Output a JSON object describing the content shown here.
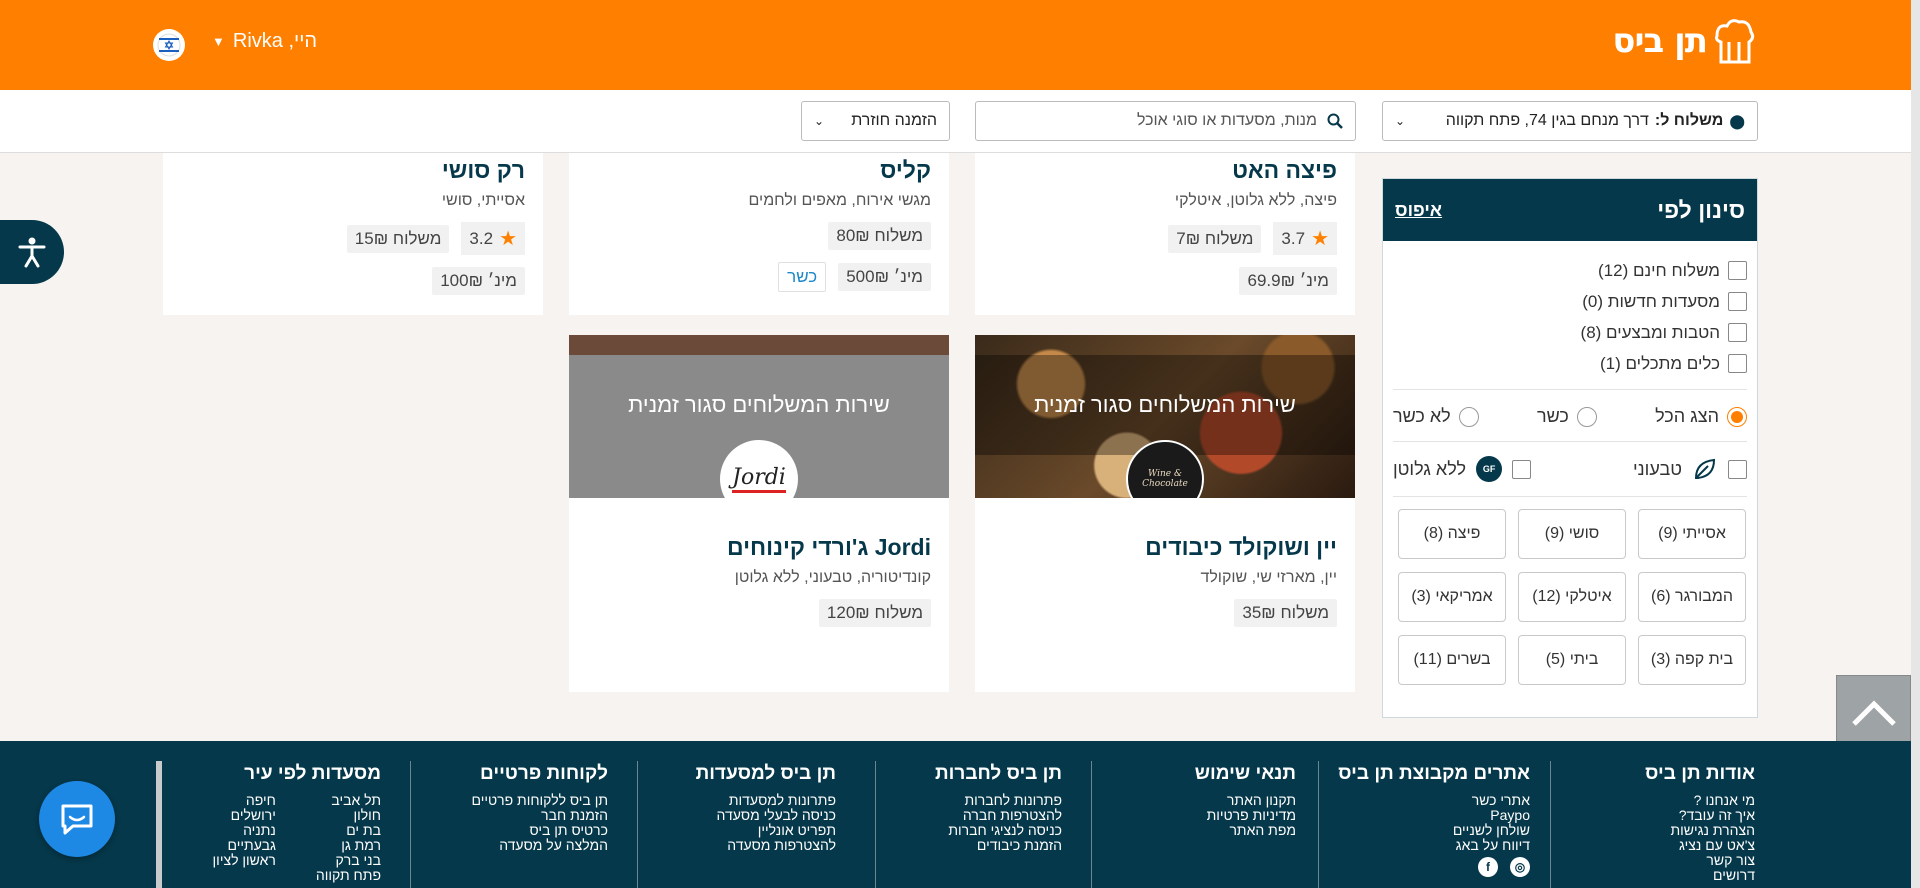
{
  "header": {
    "logo_text": "תן ביס",
    "greeting": "היי, Rivka",
    "colors": {
      "brand": "#ff8000",
      "dark": "#05384a"
    }
  },
  "subbar": {
    "address_label": "משלוח ל:",
    "address_value": "דרך מנחם בגין 74, פתח תקווה",
    "search_placeholder": "מנות, מסעדות או סוגי אוכל",
    "reorder_label": "הזמנה חוזרת"
  },
  "filter": {
    "title": "סינון לפי",
    "reset": "איפוס",
    "checks": [
      {
        "label": "משלוח חינם (12)"
      },
      {
        "label": "מסעדות חדשות (0)"
      },
      {
        "label": "הטבות ומבצעים (8)"
      },
      {
        "label": "כלים מתכלים (1)"
      }
    ],
    "kosher_options": [
      {
        "label": "הצג הכל",
        "selected": true
      },
      {
        "label": "כשר",
        "selected": false
      },
      {
        "label": "לא כשר",
        "selected": false
      }
    ],
    "diet": {
      "vegan": "טבעוני",
      "gluten_free": "ללא גלוטן",
      "gf_badge": "GF"
    },
    "categories": [
      "אסייתי (9)",
      "סושי (9)",
      "פיצה (8)",
      "המבורגר (6)",
      "איטלקי (12)",
      "אמריקאי (3)",
      "בית קפה (3)",
      "ביתי (5)",
      "בשרים (11)"
    ]
  },
  "cards_top": [
    {
      "title": "פיצה האט",
      "subtitle": "פיצה, ללא גלוטן, איטלקי",
      "rating": "3.7",
      "delivery": "משלוח 7₪",
      "min": "מינ׳ 69.9₪"
    },
    {
      "title": "קליס",
      "subtitle": "מגשי אירוח, מאפים ולחמים",
      "delivery": "משלוח 80₪",
      "min": "מינ׳ 500₪",
      "kosher": "כשר"
    },
    {
      "title": "רק סושי",
      "subtitle": "אסייתי, סושי",
      "rating": "3.2",
      "delivery": "משלוח 15₪",
      "min": "מינ׳ 100₪"
    }
  ],
  "cards_bottom": [
    {
      "banner": "שירות המשלוחים סגור זמנית",
      "title": "יין ושוקולד כיבודים",
      "subtitle": "יין, מארזי שי, שוקולד",
      "delivery": "משלוח 35₪",
      "logo_text": "Wine & Chocolate"
    },
    {
      "banner": "שירות המשלוחים סגור זמנית",
      "title": "Jordi ג'ורדי קינוחים",
      "subtitle": "קונדיטוריה, טבעוני, ללא גלוטן",
      "delivery": "משלוח 120₪",
      "logo_text": "Jordi"
    }
  ],
  "footer": {
    "cols": [
      {
        "title": "אודות תן ביס",
        "links": [
          "מי אנחנו ?",
          "איך זה עובד?",
          "הצהרת נגישות",
          "צ'אט עם נציג",
          "צור קשר",
          "דרושים"
        ]
      },
      {
        "title": "אתרים מקבוצת תן ביס",
        "links": [
          "אתרי כשר",
          "Paypo",
          "שולחן לשניים",
          "דיווח על באג"
        ]
      },
      {
        "title": "תנאי שימוש",
        "links": [
          "תקנון האתר",
          "מדיניות פרטיות",
          "מפת האתר"
        ]
      },
      {
        "title": "תן ביס לחברות",
        "links": [
          "פתרונות לחברות",
          "להצטרפות חברה",
          "כניסה לנציגי חברות",
          "הזמנת כיבודים"
        ]
      },
      {
        "title": "תן ביס למסעדות",
        "links": [
          "פתרונות למסעדות",
          "כניסה לבעלי מסעדה",
          "תפריט אונליין",
          "להצטרפות מסעדה"
        ]
      },
      {
        "title": "לקוחות פרטיים",
        "links": [
          "תן ביס ללקוחות פרטיים",
          "הזמנת חבר",
          "כרטיס תן ביס",
          "המלצה על מסעדה"
        ]
      }
    ],
    "cities_title": "מסעדות לפי עיר",
    "cities_a": [
      "תל אביב",
      "חולון",
      "בת ים",
      "רמת גן",
      "בני ברק",
      "פתח תקווה"
    ],
    "cities_b": [
      "חיפה",
      "ירושלים",
      "נתניה",
      "גבעתיים",
      "ראשון לציון"
    ]
  }
}
